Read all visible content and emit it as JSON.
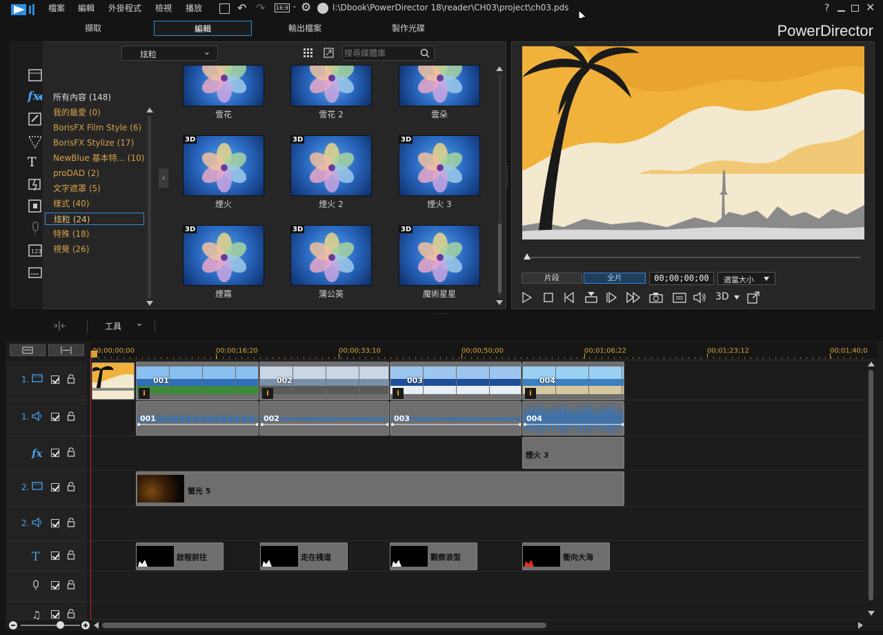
{
  "titlebar": {
    "menus": [
      "檔案",
      "編輯",
      "外掛程式",
      "檢視",
      "播放"
    ],
    "aspect": "16:9",
    "path": "I:\\Dbook\\PowerDirector 18\\reader\\CH03\\project\\ch03.pds",
    "help": "?"
  },
  "modes": [
    "擷取",
    "編輯",
    "輸出檔案",
    "製作光碟"
  ],
  "brand": "PowerDirector",
  "library": {
    "dropdown": "炫粒",
    "search_placeholder": "搜尋媒體庫",
    "categories": [
      "所有內容 (148)",
      "我的最愛  (0)",
      "BorisFX Film Style  (6)",
      "BorisFX Stylize  (17)",
      "NewBlue 基本特... (10)",
      "proDAD  (2)",
      "文字遮罩  (5)",
      "樣式  (40)",
      "炫粒  (24)",
      "特殊  (18)",
      "視覺  (26)"
    ],
    "active_category": 8,
    "items": [
      {
        "label": "雪花",
        "badge": ""
      },
      {
        "label": "雪花 2",
        "badge": ""
      },
      {
        "label": "雲朵",
        "badge": ""
      },
      {
        "label": "煙火",
        "badge": "3D"
      },
      {
        "label": "煙火 2",
        "badge": "3D"
      },
      {
        "label": "煙火 3",
        "badge": "3D"
      },
      {
        "label": "煙霧",
        "badge": "3D"
      },
      {
        "label": "蒲公英",
        "badge": "3D"
      },
      {
        "label": "魔術星星",
        "badge": "3D"
      }
    ]
  },
  "preview": {
    "clip_tab": "片段",
    "movie_tab": "全片",
    "timecode": "00;00;00;00",
    "fit": "適當大小",
    "mode3d": "3D"
  },
  "timeline": {
    "tools_label": "工具",
    "ruler": [
      "00;00;00;00",
      "00;00;16;20",
      "00;00;33;10",
      "00;00;50;00",
      "00;01;06;22",
      "00;01;23;12",
      "00;01;40;0"
    ],
    "track_numbers": [
      "1.",
      "1.",
      "",
      "2.",
      "2.",
      "",
      "",
      ""
    ],
    "video_clips": [
      "001",
      "002",
      "003",
      "004"
    ],
    "audio_clips": [
      "001",
      "002",
      "003",
      "004"
    ],
    "fx_clip": "煙火 3",
    "overlay_clip": "螢光 5",
    "titles": [
      "啟程前往",
      "走在棧道",
      "觀察浪型",
      "衝向大海"
    ]
  },
  "colors": {
    "accent": "#3a8bd8",
    "category": "#d8a24a",
    "ruler": "#d4a238",
    "playhead": "#c62828",
    "sky": "#f0b23a"
  }
}
